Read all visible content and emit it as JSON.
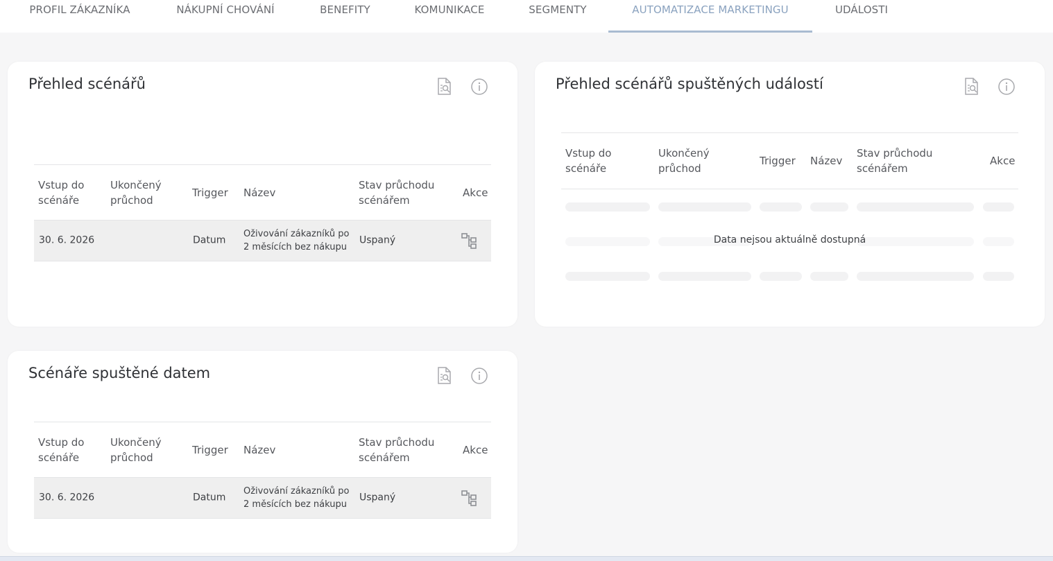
{
  "tabs": [
    {
      "label": "PROFIL ZÁKAZNÍKA",
      "active": false
    },
    {
      "label": "NÁKUPNÍ CHOVÁNÍ",
      "active": false
    },
    {
      "label": "BENEFITY",
      "active": false
    },
    {
      "label": "KOMUNIKACE",
      "active": false
    },
    {
      "label": "SEGMENTY",
      "active": false
    },
    {
      "label": "AUTOMATIZACE MARKETINGU",
      "active": true
    },
    {
      "label": "UDÁLOSTI",
      "active": false
    }
  ],
  "colors": {
    "active_tab": "#8aa2bf",
    "row_background": "#efefef",
    "icon_gray": "#a8a9ad"
  },
  "icons": {
    "report": "document-search-icon",
    "info": "info-icon",
    "action": "flow-diagram-icon"
  },
  "cards": {
    "scenario_overview": {
      "title": "Přehled scénářů",
      "columns": [
        "Vstup do scénáře",
        "Ukončený průchod",
        "Trigger",
        "Název",
        "Stav průchodu scénářem",
        "Akce"
      ],
      "rows": [
        {
          "entry": "30. 6. 2026",
          "finished": "",
          "trigger": "Datum",
          "name": "Oživování zákazníků po 2 měsících bez nákupu",
          "state": "Uspaný"
        }
      ]
    },
    "event_scenarios": {
      "title": "Přehled scénářů spuštěných událostí",
      "columns": [
        "Vstup do scénáře",
        "Ukončený průchod",
        "Trigger",
        "Název",
        "Stav průchodu scénářem",
        "Akce"
      ],
      "empty_message": "Data nejsou aktuálně dostupná"
    },
    "date_scenarios": {
      "title": "Scénáře spuštěné datem",
      "columns": [
        "Vstup do scénáře",
        "Ukončený průchod",
        "Trigger",
        "Název",
        "Stav průchodu scénářem",
        "Akce"
      ],
      "rows": [
        {
          "entry": "30. 6. 2026",
          "finished": "",
          "trigger": "Datum",
          "name": "Oživování zákazníků po 2 měsících bez nákupu",
          "state": "Uspaný"
        }
      ]
    }
  }
}
